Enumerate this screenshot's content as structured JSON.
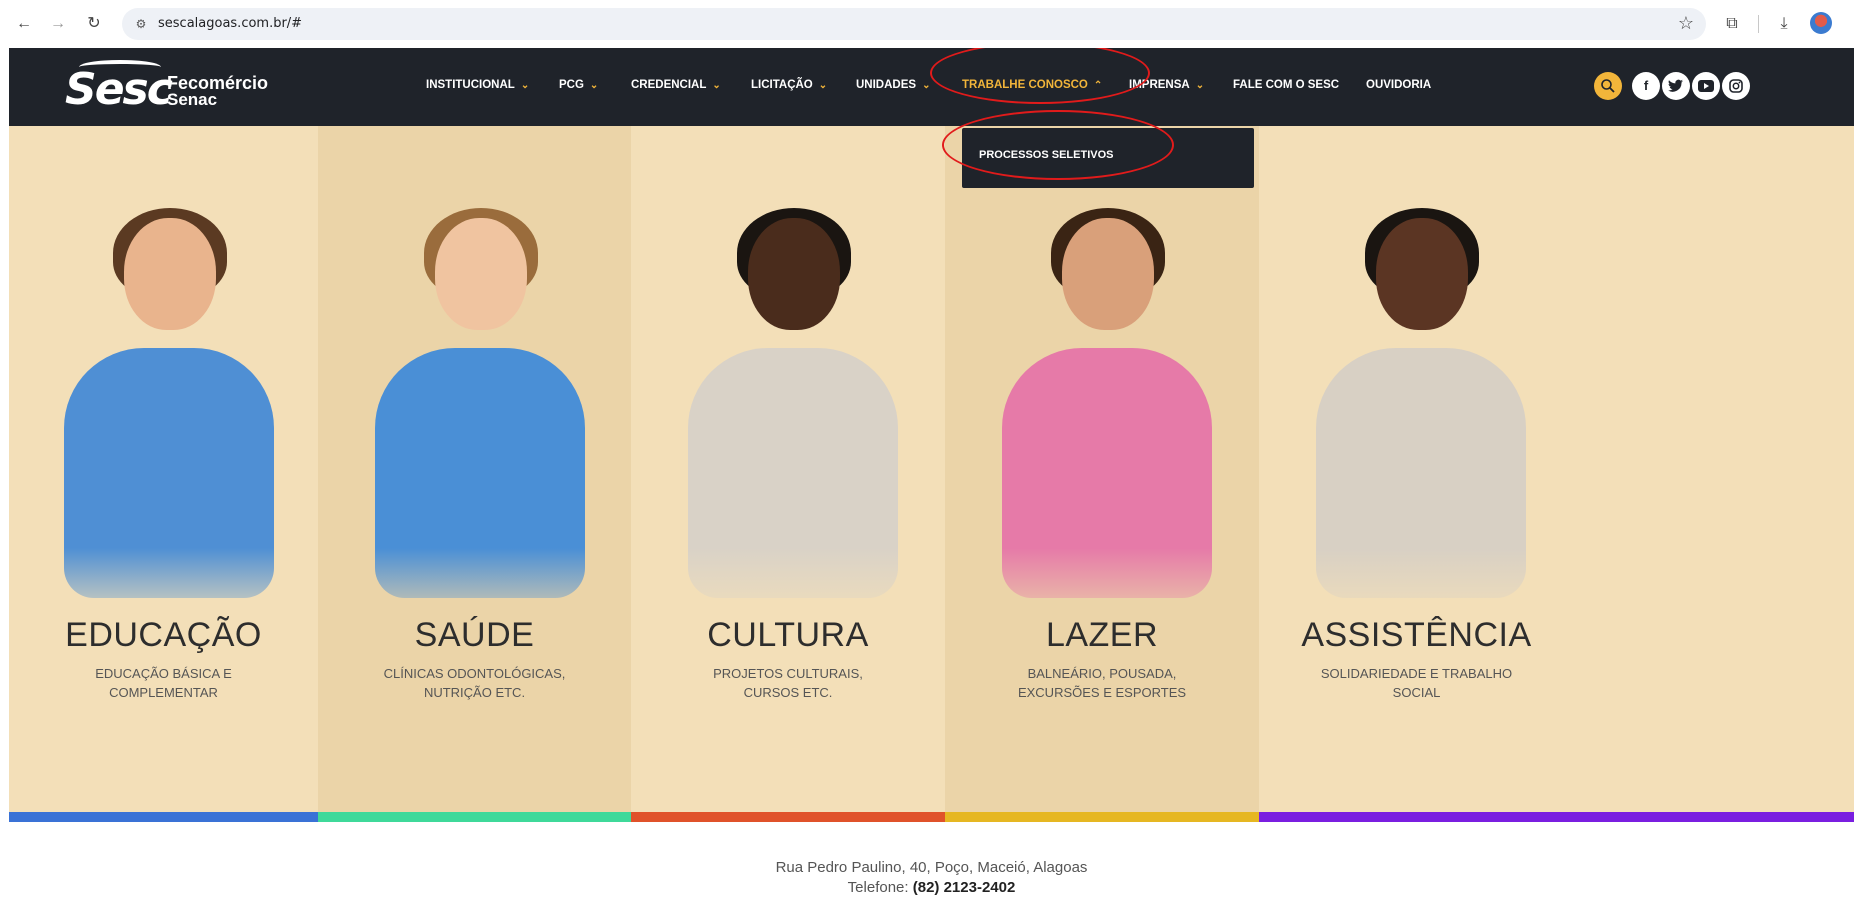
{
  "browser": {
    "url": "sescalagoas.com.br/#",
    "back_icon": "←",
    "forward_icon": "→",
    "reload_icon": "↻",
    "star_icon": "☆",
    "extensions_icon": "⧉",
    "download_icon": "⤓"
  },
  "header": {
    "logo": {
      "sesc": "Sesc",
      "fecomercio": "Fecomércio",
      "senac": "Senac"
    },
    "menu": [
      {
        "label": "INSTITUCIONAL",
        "has_dropdown": true
      },
      {
        "label": "PCG",
        "has_dropdown": true
      },
      {
        "label": "CREDENCIAL",
        "has_dropdown": true
      },
      {
        "label": "LICITAÇÃO",
        "has_dropdown": true
      },
      {
        "label": "UNIDADES",
        "has_dropdown": true
      },
      {
        "label": "TRABALHE CONOSCO",
        "has_dropdown": true,
        "active": true
      },
      {
        "label": "IMPRENSA",
        "has_dropdown": true
      },
      {
        "label": "FALE COM O SESC",
        "has_dropdown": false
      },
      {
        "label": "OUVIDORIA",
        "has_dropdown": false
      }
    ],
    "chevron_down": "⌄",
    "chevron_up": "⌃",
    "social_icons": [
      "search-icon",
      "facebook-icon",
      "twitter-icon",
      "youtube-icon",
      "instagram-icon"
    ],
    "accent_color": "#f2b53a",
    "bg_color": "#1f232a"
  },
  "dropdown": {
    "items": [
      {
        "label": "PROCESSOS SELETIVOS"
      }
    ]
  },
  "panels": [
    {
      "title": "EDUCAÇÃO",
      "subtitle": [
        "EDUCAÇÃO BÁSICA E",
        "COMPLEMENTAR"
      ],
      "stripe_color": "#3a72d6"
    },
    {
      "title": "SAÚDE",
      "subtitle": [
        "CLÍNICAS ODONTOLÓGICAS,",
        "NUTRIÇÃO ETC."
      ],
      "stripe_color": "#3fd99a"
    },
    {
      "title": "CULTURA",
      "subtitle": [
        "PROJETOS CULTURAIS,",
        "CURSOS ETC."
      ],
      "stripe_color": "#e0522a"
    },
    {
      "title": "LAZER",
      "subtitle": [
        "BALNEÁRIO, POUSADA,",
        "EXCURSÕES E ESPORTES"
      ],
      "stripe_color": "#e6b722"
    },
    {
      "title": "ASSISTÊNCIA",
      "subtitle": [
        "SOLIDARIEDADE E TRABALHO",
        "SOCIAL"
      ],
      "stripe_color": "#7a1ee0"
    }
  ],
  "footer": {
    "address": "Rua Pedro Paulino, 40, Poço, Maceió, Alagoas",
    "phone_label": "Telefone:",
    "phone_number": "(82) 2123-2402"
  }
}
